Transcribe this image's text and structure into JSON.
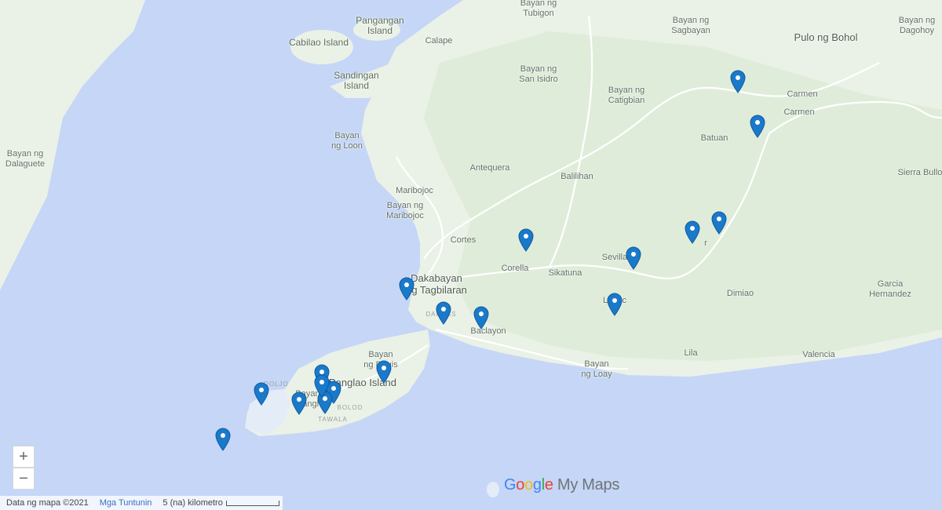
{
  "colors": {
    "water": "#c5d6f7",
    "land": "#eaf1e6",
    "land_green": "#dbead7",
    "road": "#ffffff",
    "pin": "#1b79c9"
  },
  "labels": {
    "pangangan": "Pangangan\nIsland",
    "calape": "Calape",
    "cabilao": "Cabilao Island",
    "sandingan": "Sandingan\nIsland",
    "tubigon": "Bayan ng\nTubigon",
    "sagbayan": "Bayan ng\nSagbayan",
    "pulo": "Pulo ng Bohol",
    "dagohoy": "Bayan ng\nDagohoy",
    "san_isidro": "Bayan ng\nSan Isidro",
    "catigbian": "Bayan ng\nCatigbian",
    "carmen1": "Carmen",
    "carmen2": "Carmen",
    "batuan": "Batuan",
    "loon": "Bayan\nng Loon",
    "dalaguete": "Bayan ng\nDalaguete",
    "antequera": "Antequera",
    "balilihan": "Balilihan",
    "sierra": "Sierra Bullo",
    "maribojoc1": "Maribojoc",
    "maribojoc2": "Bayan ng\nMaribojoc",
    "cortes": "Cortes",
    "sevilla": "Sevilla",
    "bilar": "r",
    "dakabayan": "Dakabayan\nng Tagbilaran",
    "corella": "Corella",
    "sikatuna": "Sikatuna",
    "garcia": "Garcia\nHernandez",
    "dimiao": "Dimiao",
    "loboc": "Loboc",
    "dampas": "DAMPAS",
    "baclayon": "Baclayon",
    "dauis": "Bayan\nng Dauis",
    "panglao": "Panglao Island",
    "loay": "Bayan\nng Loay",
    "lila": "Lila",
    "valencia": "Valencia",
    "doljo": "DOLJO",
    "tawala": "TAWALA",
    "bolod": "BOLOD",
    "bayan_panglao": "Bayan\nPangl"
  },
  "pins": [
    {
      "name": "map-pin"
    },
    {
      "name": "map-pin"
    },
    {
      "name": "map-pin"
    },
    {
      "name": "map-pin"
    },
    {
      "name": "map-pin"
    },
    {
      "name": "map-pin"
    },
    {
      "name": "map-pin"
    },
    {
      "name": "map-pin"
    },
    {
      "name": "map-pin"
    },
    {
      "name": "map-pin"
    },
    {
      "name": "map-pin"
    },
    {
      "name": "map-pin"
    },
    {
      "name": "map-pin"
    },
    {
      "name": "map-pin"
    },
    {
      "name": "map-pin"
    },
    {
      "name": "map-pin"
    },
    {
      "name": "map-pin"
    },
    {
      "name": "map-pin"
    },
    {
      "name": "map-pin"
    }
  ],
  "controls": {
    "zoom_in": "+",
    "zoom_out": "−"
  },
  "footer": {
    "data": "Data ng mapa ©2021",
    "terms": "Mga Tuntunin",
    "scale": "5 (na) kilometro"
  },
  "brand": {
    "g1": "G",
    "g2": "o",
    "g3": "o",
    "g4": "g",
    "g5": "l",
    "g6": "e",
    "rest": " My Maps"
  }
}
